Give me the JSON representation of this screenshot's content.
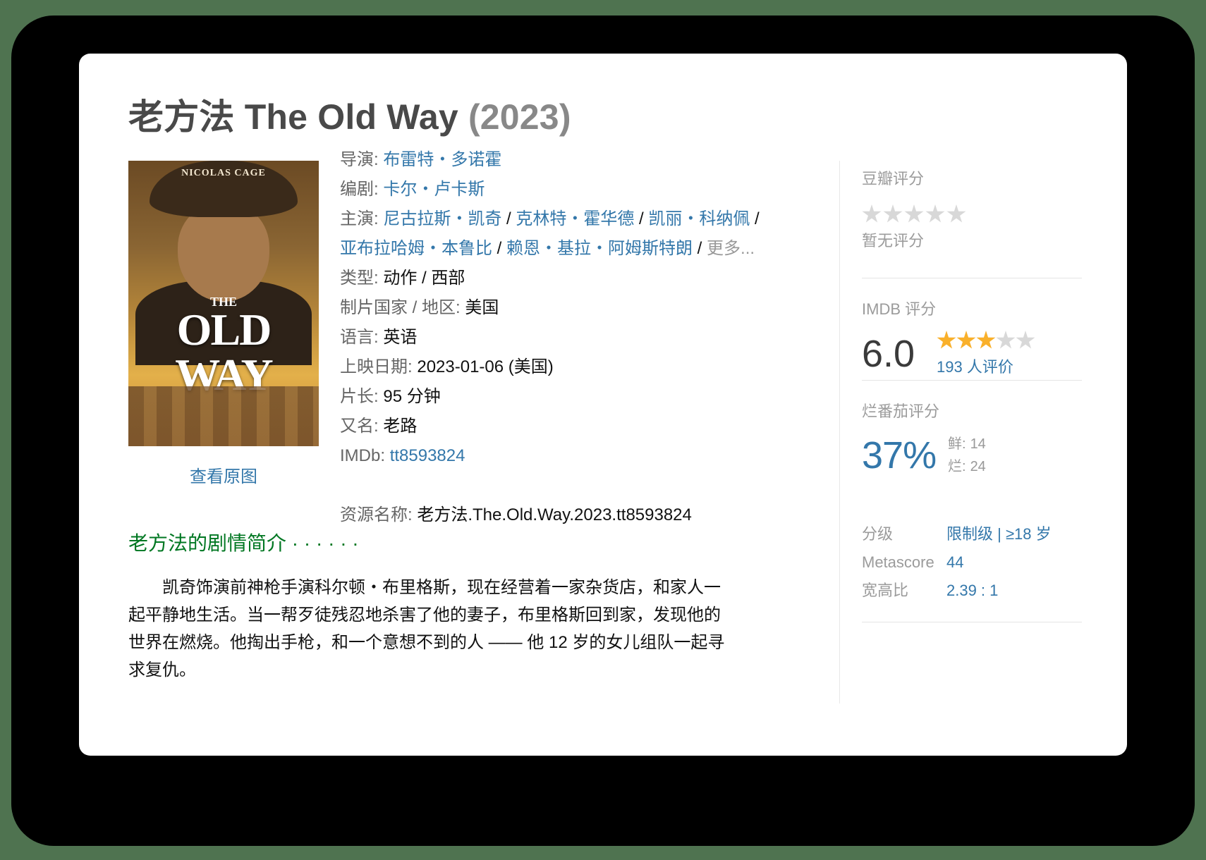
{
  "movie": {
    "title": "老方法 The Old Way",
    "year": "(2023)"
  },
  "poster": {
    "actor_text": "NICOLAS CAGE",
    "the_text": "THE",
    "title_text": "OLD WAY",
    "view_original": "查看原图"
  },
  "info": {
    "director_label": "导演:",
    "director": "布雷特・多诺霍",
    "writer_label": "编剧:",
    "writer": "卡尔・卢卡斯",
    "cast_label": "主演:",
    "cast": [
      "尼古拉斯・凯奇",
      "克林特・霍华德",
      "凯丽・科纳佩",
      "亚布拉哈姆・本鲁比",
      "赖恩・基拉・阿姆斯特朗"
    ],
    "separator": " / ",
    "more": "更多...",
    "genre_label": "类型:",
    "genre": "动作 / 西部",
    "country_label": "制片国家 / 地区:",
    "country": "美国",
    "language_label": "语言:",
    "language": "英语",
    "release_label": "上映日期:",
    "release": "2023-01-06 (美国)",
    "runtime_label": "片长:",
    "runtime": "95 分钟",
    "aka_label": "又名:",
    "aka": "老路",
    "imdb_label": "IMDb:",
    "imdb_id": "tt8593824",
    "resource_label": "资源名称:",
    "resource": "老方法.The.Old.Way.2023.tt8593824"
  },
  "douban": {
    "label": "豆瓣评分",
    "stars": 0,
    "no_rating": "暂无评分"
  },
  "imdb": {
    "label": "IMDB 评分",
    "score": "6.0",
    "stars": 3,
    "count": "193 人评价"
  },
  "rotten": {
    "label": "烂番茄评分",
    "percent": "37%",
    "fresh_label": "鲜:",
    "fresh": "14",
    "rotten_label": "烂:",
    "rotten": "24"
  },
  "meta": {
    "rating_label": "分级",
    "rating": "限制级 | ≥18 岁",
    "metascore_label": "Metascore",
    "metascore": "44",
    "aspect_label": "宽高比",
    "aspect": "2.39 : 1"
  },
  "synopsis": {
    "title": "老方法的剧情简介 · · · · · ·",
    "text": "凯奇饰演前神枪手演科尔顿・布里格斯，现在经营着一家杂货店，和家人一起平静地生活。当一帮歹徒残忍地杀害了他的妻子，布里格斯回到家，发现他的世界在燃烧。他掏出手枪，和一个意想不到的人 —— 他 12 岁的女儿组队一起寻求复仇。"
  },
  "colors": {
    "link": "#3377aa",
    "green": "#007722",
    "star": "#f9b02b"
  }
}
